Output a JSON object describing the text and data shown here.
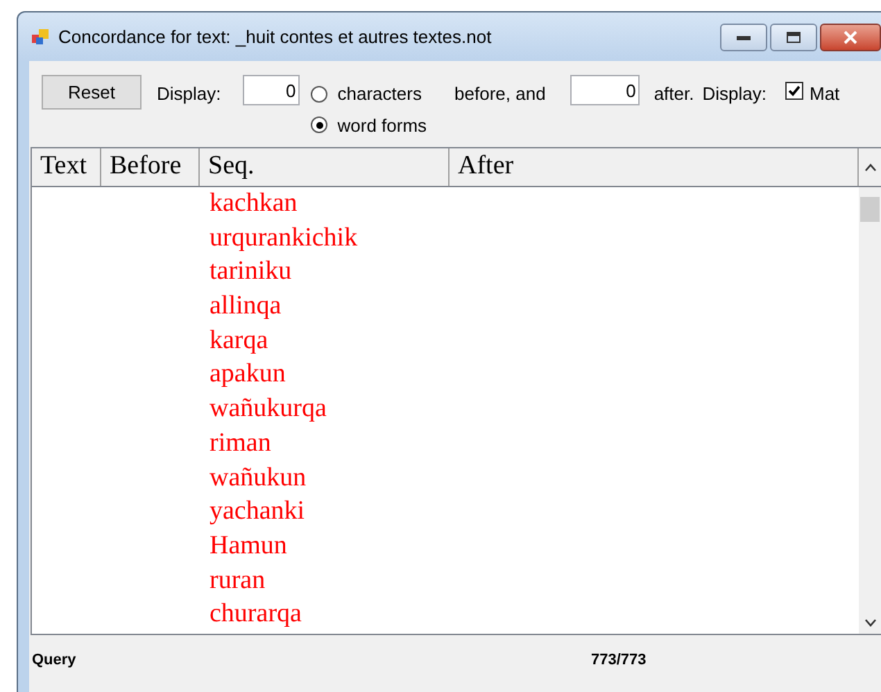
{
  "window": {
    "title": "Concordance for text: _huit contes et autres textes.not"
  },
  "toolbar": {
    "reset_button": "Reset",
    "display_label": "Display:",
    "before_value": "0",
    "units": [
      {
        "label": "characters",
        "selected": false
      },
      {
        "label": "word forms",
        "selected": true
      }
    ],
    "before_and_label": "before, and",
    "after_value": "0",
    "after_label": "after.",
    "display_label_2": "Display:",
    "match_checkbox": {
      "label": "Mat",
      "checked": true
    }
  },
  "table": {
    "columns": [
      "Text",
      "Before",
      "Seq.",
      "After"
    ],
    "rows": [
      {
        "seq": "kachkan"
      },
      {
        "seq": "urqurankichik"
      },
      {
        "seq": "tariniku"
      },
      {
        "seq": "allinqa"
      },
      {
        "seq": "karqa"
      },
      {
        "seq": "apakun"
      },
      {
        "seq": "wañukurqa"
      },
      {
        "seq": "riman"
      },
      {
        "seq": "wañukun"
      },
      {
        "seq": "yachanki"
      },
      {
        "seq": "Hamun"
      },
      {
        "seq": "ruran"
      },
      {
        "seq": "churarqa"
      }
    ]
  },
  "status_bar": {
    "query": "Query",
    "count": "773/773"
  }
}
